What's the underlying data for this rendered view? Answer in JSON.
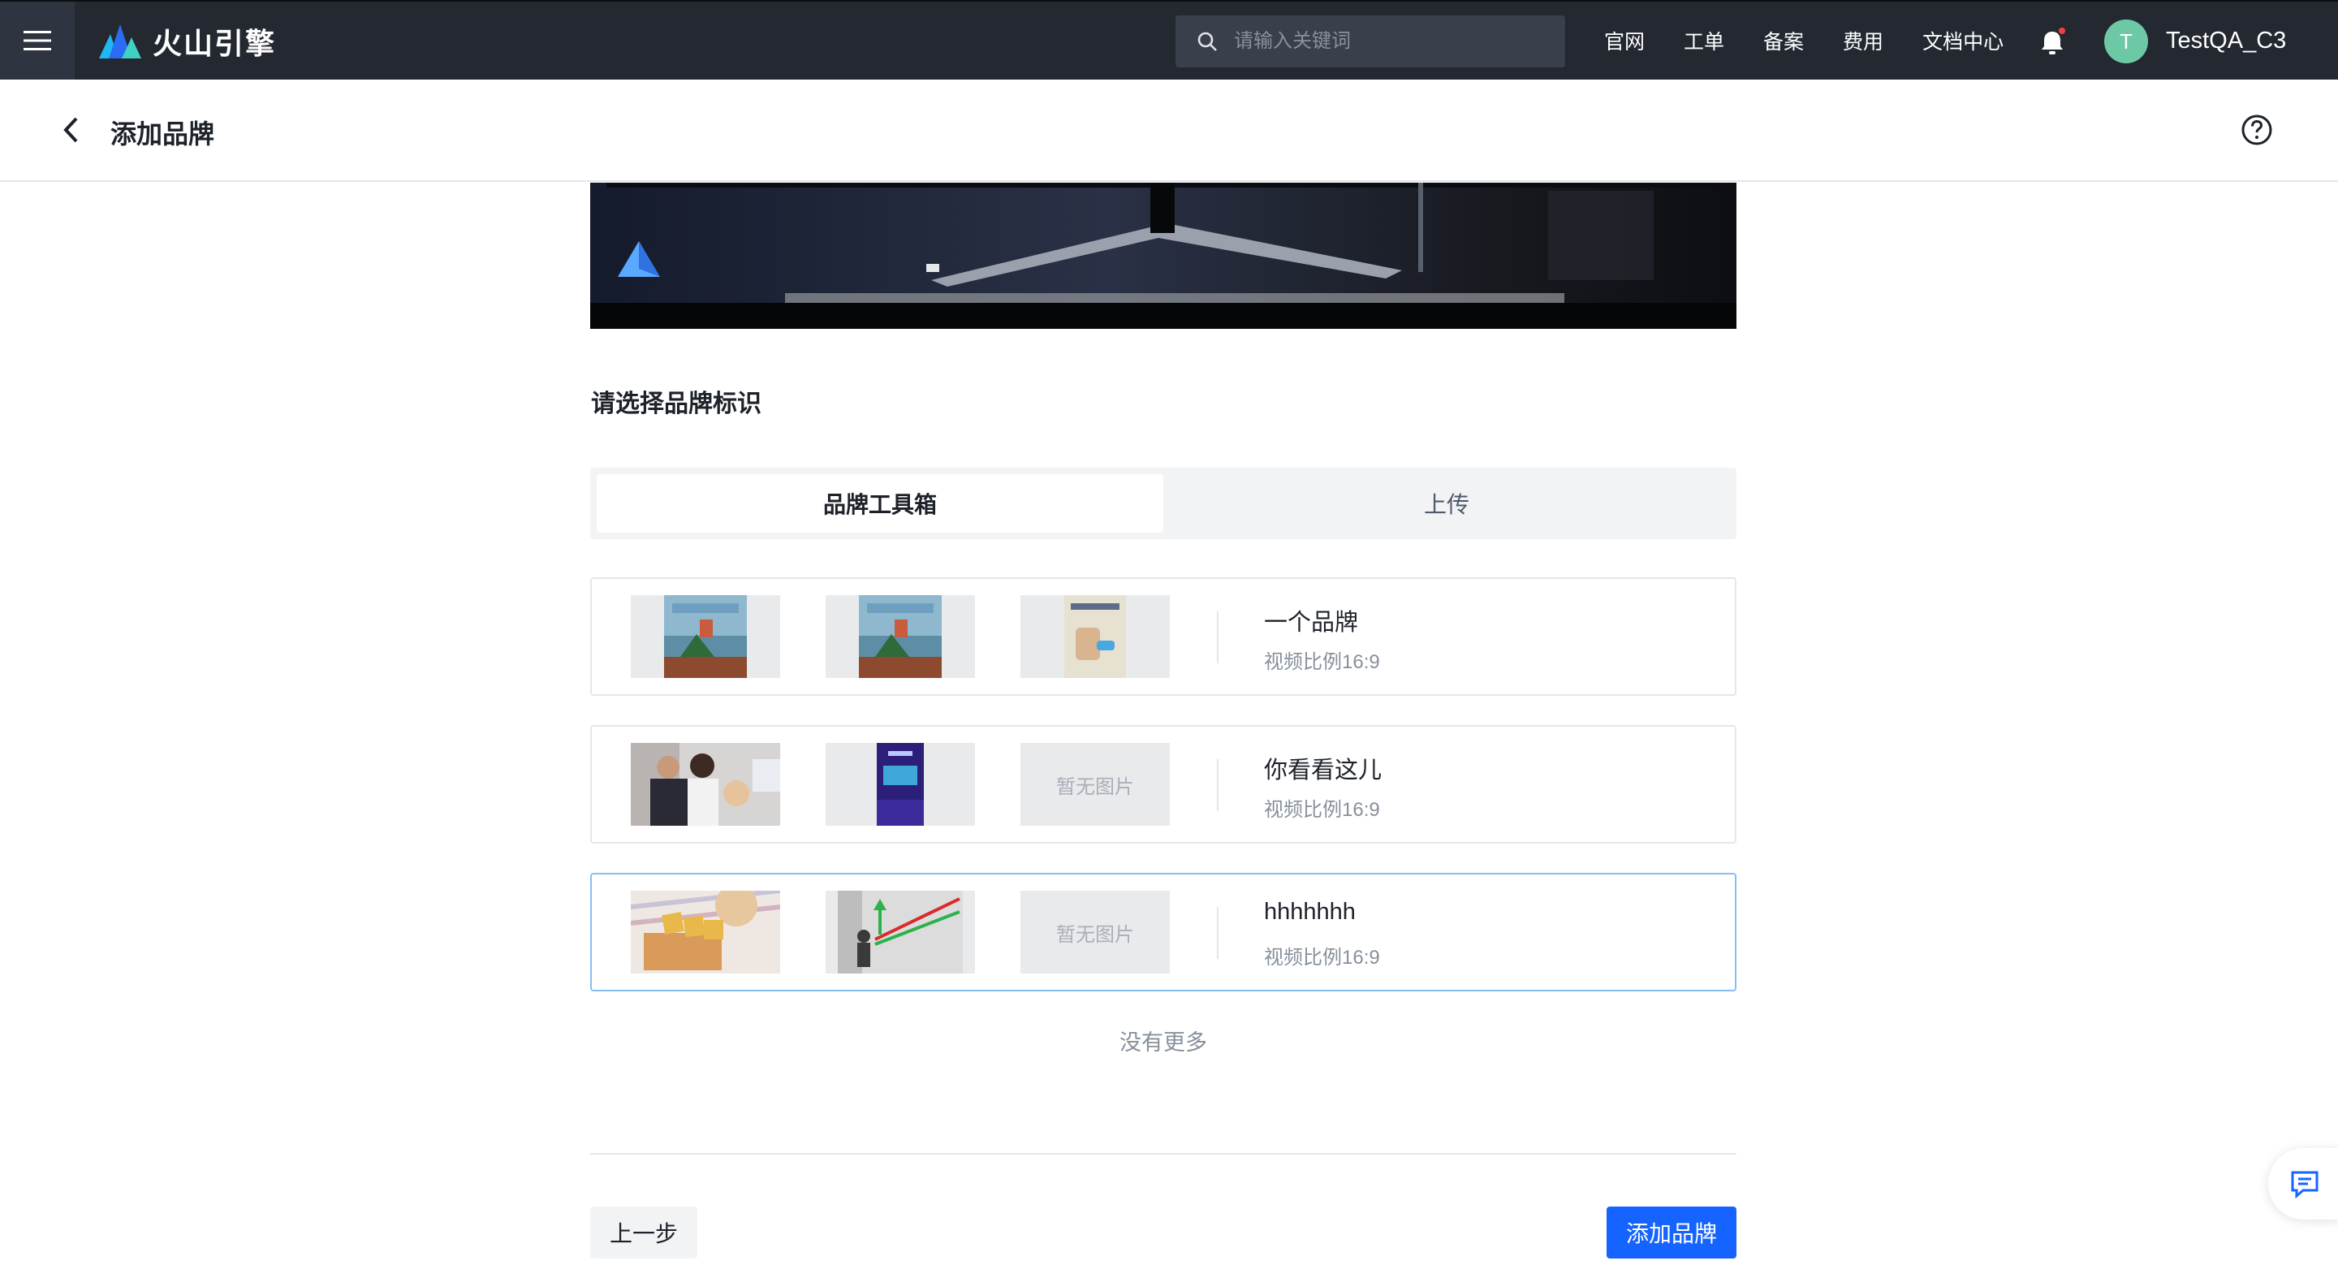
{
  "topbar": {
    "logo_text": "火山引擎",
    "search_placeholder": "请输入关键词",
    "links": [
      "官网",
      "工单",
      "备案",
      "费用",
      "文档中心"
    ],
    "avatar_initial": "T",
    "username": "TestQA_C3"
  },
  "page": {
    "title": "添加品牌"
  },
  "section": {
    "title": "请选择品牌标识",
    "tabs": [
      {
        "label": "品牌工具箱",
        "active": true
      },
      {
        "label": "上传",
        "active": false
      }
    ]
  },
  "brands": [
    {
      "name": "一个品牌",
      "ratio": "视频比例16:9",
      "thumbnails": [
        "city-image",
        "city-image",
        "product-image"
      ],
      "selected": false
    },
    {
      "name": "你看看这儿",
      "ratio": "视频比例16:9",
      "thumbnails": [
        "people-image",
        "tech-image",
        "none"
      ],
      "selected": false
    },
    {
      "name": "hhhhhhh",
      "ratio": "视频比例16:9",
      "thumbnails": [
        "pmi-image",
        "arrows-image",
        "none"
      ],
      "selected": true
    }
  ],
  "empty_thumb_label": "暂无图片",
  "list_end_label": "没有更多",
  "footer": {
    "prev_label": "上一步",
    "submit_label": "添加品牌"
  },
  "colors": {
    "primary": "#1664ff",
    "navbar": "#232831",
    "avatar": "#6dc9a5",
    "selected_border": "#86bdf5"
  }
}
